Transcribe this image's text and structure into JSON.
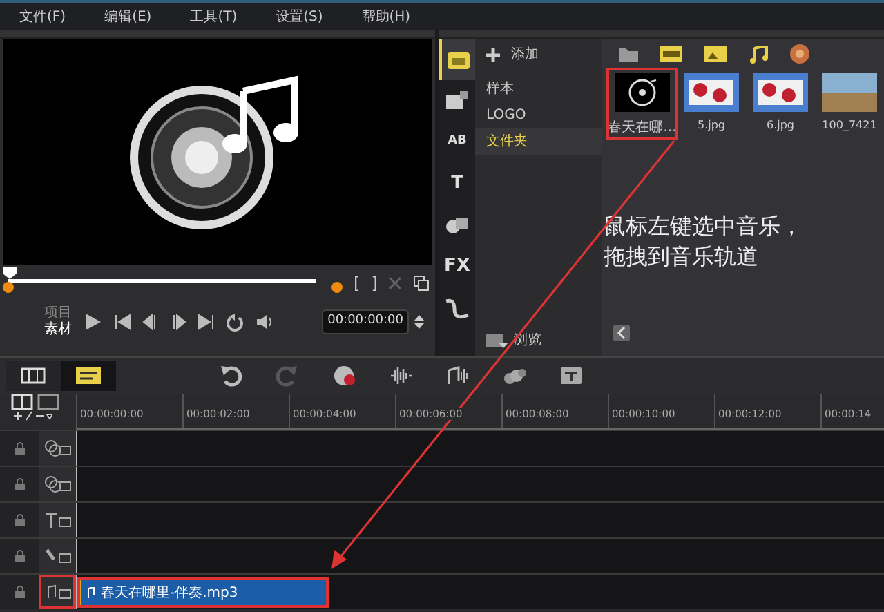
{
  "menu": [
    {
      "label": "文件(F)"
    },
    {
      "label": "编辑(E)"
    },
    {
      "label": "工具(T)"
    },
    {
      "label": "设置(S)"
    },
    {
      "label": "帮助(H)"
    }
  ],
  "player": {
    "modes": [
      {
        "label": "项目",
        "selected": false
      },
      {
        "label": "素材",
        "selected": true
      }
    ],
    "mark_in": "[",
    "mark_out": "]",
    "cut_disabled": true,
    "timecode": "00:00:00:00"
  },
  "library": {
    "side_tabs": [
      {
        "kind": "media",
        "selected": true
      },
      {
        "kind": "instant",
        "selected": false
      },
      {
        "kind": "transition",
        "label": "AB",
        "selected": false
      },
      {
        "kind": "title",
        "label": "T",
        "selected": false
      },
      {
        "kind": "graphic",
        "selected": false
      },
      {
        "kind": "filter",
        "label": "FX",
        "selected": false
      },
      {
        "kind": "path",
        "selected": false
      }
    ],
    "add_label": "添加",
    "categories": [
      {
        "label": "样本",
        "selected": false
      },
      {
        "label": "LOGO",
        "selected": false
      },
      {
        "label": "文件夹",
        "selected": true
      }
    ],
    "browse_label": "浏览",
    "items": [
      {
        "kind": "audio",
        "caption": "春天在哪...",
        "annotated": true
      },
      {
        "kind": "image",
        "caption": "5.jpg",
        "annotated": false
      },
      {
        "kind": "image",
        "caption": "6.jpg",
        "annotated": false
      },
      {
        "kind": "photo",
        "caption": "100_7421",
        "annotated": false
      }
    ]
  },
  "timeline": {
    "toolbar": [
      {
        "kind": "undo",
        "disabled": false
      },
      {
        "kind": "redo",
        "disabled": true
      },
      {
        "kind": "record",
        "disabled": false
      },
      {
        "kind": "mixer",
        "disabled": false
      },
      {
        "kind": "automusic",
        "disabled": false
      },
      {
        "kind": "motion",
        "disabled": false
      },
      {
        "kind": "subtitle",
        "disabled": false
      }
    ],
    "views": [
      {
        "kind": "storyboard",
        "selected": false
      },
      {
        "kind": "timeline",
        "selected": true
      }
    ],
    "ruler": [
      "00:00:00:00",
      "00:00:02:00",
      "00:00:04:00",
      "00:00:06:00",
      "00:00:08:00",
      "00:00:10:00",
      "00:00:12:00",
      "00:00:14"
    ],
    "tracks": [
      {
        "kind": "overlay",
        "annotated": false
      },
      {
        "kind": "overlay",
        "annotated": false
      },
      {
        "kind": "title",
        "annotated": false
      },
      {
        "kind": "voice",
        "annotated": false
      },
      {
        "kind": "music",
        "annotated": true,
        "clip": {
          "label": "春天在哪里-伴奏.mp3",
          "annotated": true
        }
      }
    ]
  },
  "annotation": {
    "text": "鼠标左键选中音乐，拖拽到音乐轨道"
  }
}
